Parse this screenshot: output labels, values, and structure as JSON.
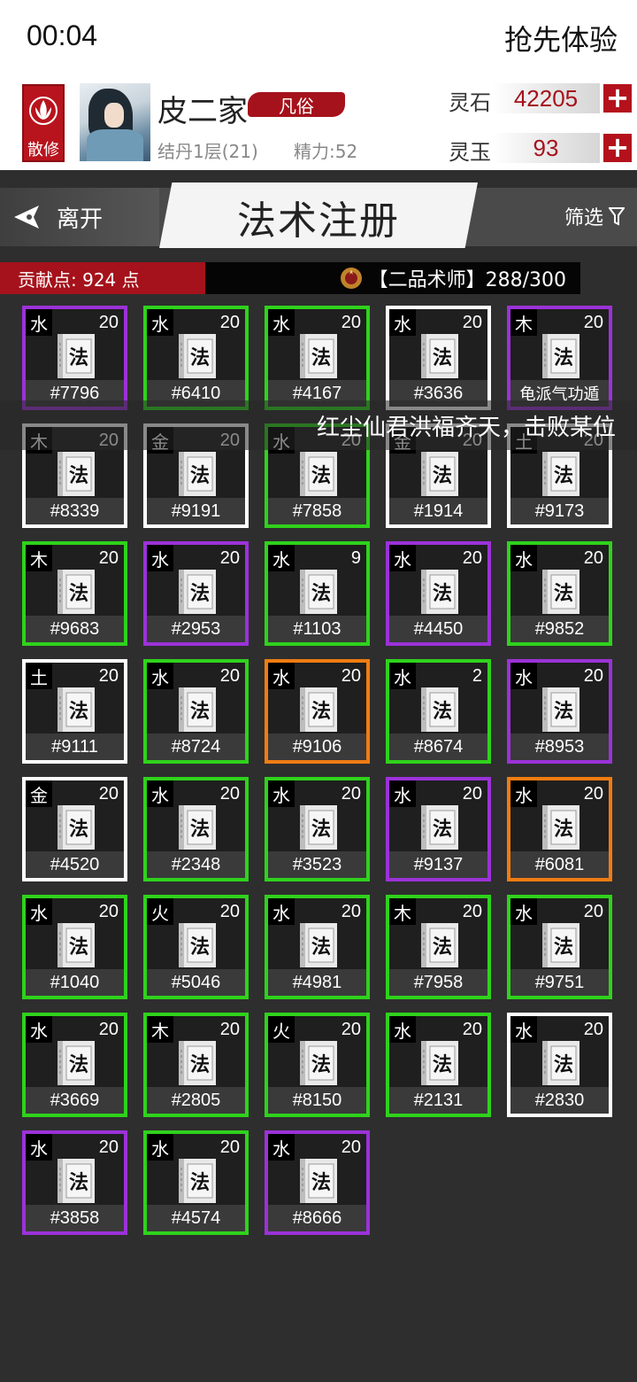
{
  "status_bar": {
    "time": "00:04",
    "early_access": "抢先体验"
  },
  "player": {
    "sect_badge": "散修",
    "name": "皮二家",
    "rank_tag": "凡俗",
    "realm": "结丹1层(21)",
    "energy": "精力:52"
  },
  "resources": [
    {
      "label": "灵石",
      "value": "42205"
    },
    {
      "label": "灵玉",
      "value": "93"
    }
  ],
  "nav": {
    "leave": "离开",
    "title": "法术注册",
    "filter": "筛选"
  },
  "contribution": {
    "points": "贡献点: 924 点",
    "rank": "【二品术师】288/300"
  },
  "book_glyph": "法",
  "broadcast": "红尘仙君洪福齐天，击败某位",
  "colors": {
    "green": "#2fd21c",
    "purple": "#9b32d8",
    "white": "#ffffff",
    "orange": "#f07c12",
    "accent_red": "#a5121b"
  },
  "cards": [
    {
      "element": "水",
      "level": "20",
      "id": "#7796",
      "quality": "purple"
    },
    {
      "element": "水",
      "level": "20",
      "id": "#6410",
      "quality": "green"
    },
    {
      "element": "水",
      "level": "20",
      "id": "#4167",
      "quality": "green"
    },
    {
      "element": "水",
      "level": "20",
      "id": "#3636",
      "quality": "white"
    },
    {
      "element": "木",
      "level": "20",
      "id": "龟派气功遁",
      "quality": "purple"
    },
    {
      "element": "木",
      "level": "20",
      "id": "#8339",
      "quality": "white"
    },
    {
      "element": "金",
      "level": "20",
      "id": "#9191",
      "quality": "white"
    },
    {
      "element": "水",
      "level": "20",
      "id": "#7858",
      "quality": "green"
    },
    {
      "element": "金",
      "level": "20",
      "id": "#1914",
      "quality": "white"
    },
    {
      "element": "土",
      "level": "20",
      "id": "#9173",
      "quality": "white"
    },
    {
      "element": "木",
      "level": "20",
      "id": "#9683",
      "quality": "green"
    },
    {
      "element": "水",
      "level": "20",
      "id": "#2953",
      "quality": "purple"
    },
    {
      "element": "水",
      "level": "9",
      "id": "#1103",
      "quality": "green"
    },
    {
      "element": "水",
      "level": "20",
      "id": "#4450",
      "quality": "purple"
    },
    {
      "element": "水",
      "level": "20",
      "id": "#9852",
      "quality": "green"
    },
    {
      "element": "土",
      "level": "20",
      "id": "#9111",
      "quality": "white"
    },
    {
      "element": "水",
      "level": "20",
      "id": "#8724",
      "quality": "green"
    },
    {
      "element": "水",
      "level": "20",
      "id": "#9106",
      "quality": "orange"
    },
    {
      "element": "水",
      "level": "2",
      "id": "#8674",
      "quality": "green"
    },
    {
      "element": "水",
      "level": "20",
      "id": "#8953",
      "quality": "purple"
    },
    {
      "element": "金",
      "level": "20",
      "id": "#4520",
      "quality": "white"
    },
    {
      "element": "水",
      "level": "20",
      "id": "#2348",
      "quality": "green"
    },
    {
      "element": "水",
      "level": "20",
      "id": "#3523",
      "quality": "green"
    },
    {
      "element": "水",
      "level": "20",
      "id": "#9137",
      "quality": "purple"
    },
    {
      "element": "水",
      "level": "20",
      "id": "#6081",
      "quality": "orange"
    },
    {
      "element": "水",
      "level": "20",
      "id": "#1040",
      "quality": "green"
    },
    {
      "element": "火",
      "level": "20",
      "id": "#5046",
      "quality": "green"
    },
    {
      "element": "水",
      "level": "20",
      "id": "#4981",
      "quality": "green"
    },
    {
      "element": "木",
      "level": "20",
      "id": "#7958",
      "quality": "green"
    },
    {
      "element": "水",
      "level": "20",
      "id": "#9751",
      "quality": "green"
    },
    {
      "element": "水",
      "level": "20",
      "id": "#3669",
      "quality": "green"
    },
    {
      "element": "木",
      "level": "20",
      "id": "#2805",
      "quality": "green"
    },
    {
      "element": "火",
      "level": "20",
      "id": "#8150",
      "quality": "green"
    },
    {
      "element": "水",
      "level": "20",
      "id": "#2131",
      "quality": "green"
    },
    {
      "element": "水",
      "level": "20",
      "id": "#2830",
      "quality": "white"
    },
    {
      "element": "水",
      "level": "20",
      "id": "#3858",
      "quality": "purple"
    },
    {
      "element": "水",
      "level": "20",
      "id": "#4574",
      "quality": "green"
    },
    {
      "element": "水",
      "level": "20",
      "id": "#8666",
      "quality": "purple"
    }
  ]
}
